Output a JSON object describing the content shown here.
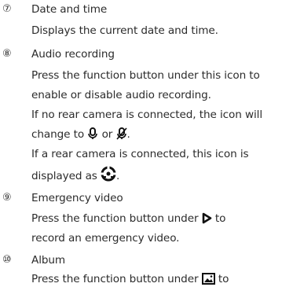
{
  "sections": [
    {
      "number": "⑦",
      "title": "Date and time",
      "lines": [
        "Displays the current date and time."
      ]
    },
    {
      "number": "⑧",
      "title": "Audio recording",
      "lines": [
        "Press the function button under this icon to",
        "enable or disable audio recording.",
        "If no rear camera is connected, the icon will",
        "change to",
        "or",
        ".",
        "If a rear camera is connected, this icon is",
        "displayed as",
        "."
      ]
    },
    {
      "number": "⑨",
      "title": "Emergency video",
      "lines": [
        "Press the function button under",
        "to",
        "record an emergency video."
      ]
    },
    {
      "number": "⑩",
      "title": "Album",
      "lines": [
        "Press the function button under",
        "to"
      ]
    }
  ],
  "icons": {
    "mic_on": "microphone-icon",
    "mic_off": "microphone-muted-icon",
    "rear_cam": "rear-camera-audio-icon",
    "emergency": "play-triangle-icon",
    "album": "album-icon"
  }
}
